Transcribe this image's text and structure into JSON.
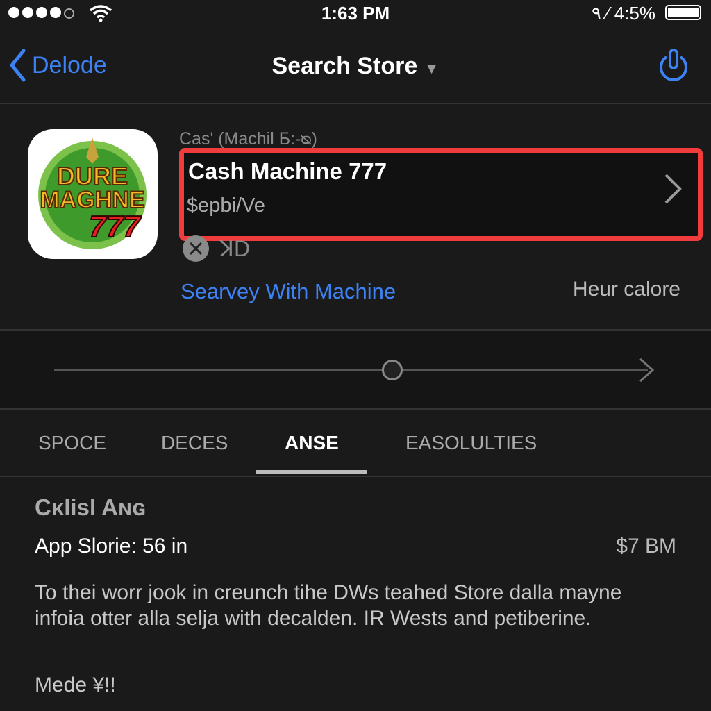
{
  "status_bar": {
    "time": "1:63 PM",
    "right_text": "٩ ⁄ 4:5%",
    "signal_bars": 4
  },
  "nav": {
    "back_label": "Delode",
    "title": "Search Store",
    "power_icon": "power-icon"
  },
  "app": {
    "icon_text_top": "DURE",
    "icon_text_mid": "MAGHNE",
    "icon_text_num": "777",
    "small_caption": "Cas' (Machil Б:-ᴓ)",
    "name": "Cash Machine 777",
    "subtitle": "$epbi/Ve",
    "rating_label": "ꓘD",
    "link": "Searvey With Machine",
    "side_text": "Heur calore"
  },
  "slider": {
    "value": 0.57
  },
  "tabs": [
    {
      "label": "SPOCE"
    },
    {
      "label": "DECES"
    },
    {
      "label": "ANSE",
      "active": true
    },
    {
      "label": "EASOLULTIES"
    }
  ],
  "details": {
    "heading": "Cκlisl Aɴɢ",
    "stat_label": "App Slorie: 56 in",
    "stat_value": "$7 BM",
    "paragraph": "To thei worr jook in creunch tihe DWs teahed Store dalla mayne infoia otter alla selja with decalden. IR Wests and petiberine.",
    "footer": "Mede ¥!!"
  },
  "colors": {
    "accent": "#3d82f5",
    "highlight": "#f03c3c",
    "background": "#1a1a1a"
  }
}
